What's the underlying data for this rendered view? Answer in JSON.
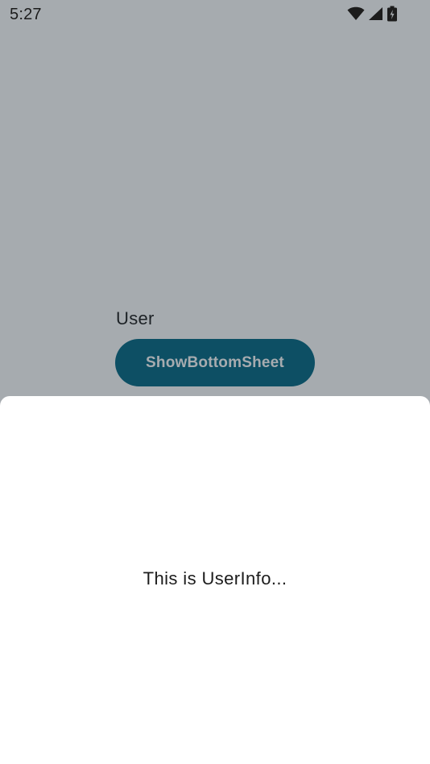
{
  "status_bar": {
    "time": "5:27",
    "icons": [
      "wifi-icon",
      "cellular-signal-icon",
      "battery-charging-icon"
    ]
  },
  "main": {
    "user_label": "User",
    "show_sheet_button_label": "ShowBottomSheet"
  },
  "bottom_sheet": {
    "text": "This is UserInfo..."
  },
  "colors": {
    "button_background": "#006783",
    "scrim": "rgba(33,45,56,0.40)",
    "sheet_background": "#ffffff"
  }
}
